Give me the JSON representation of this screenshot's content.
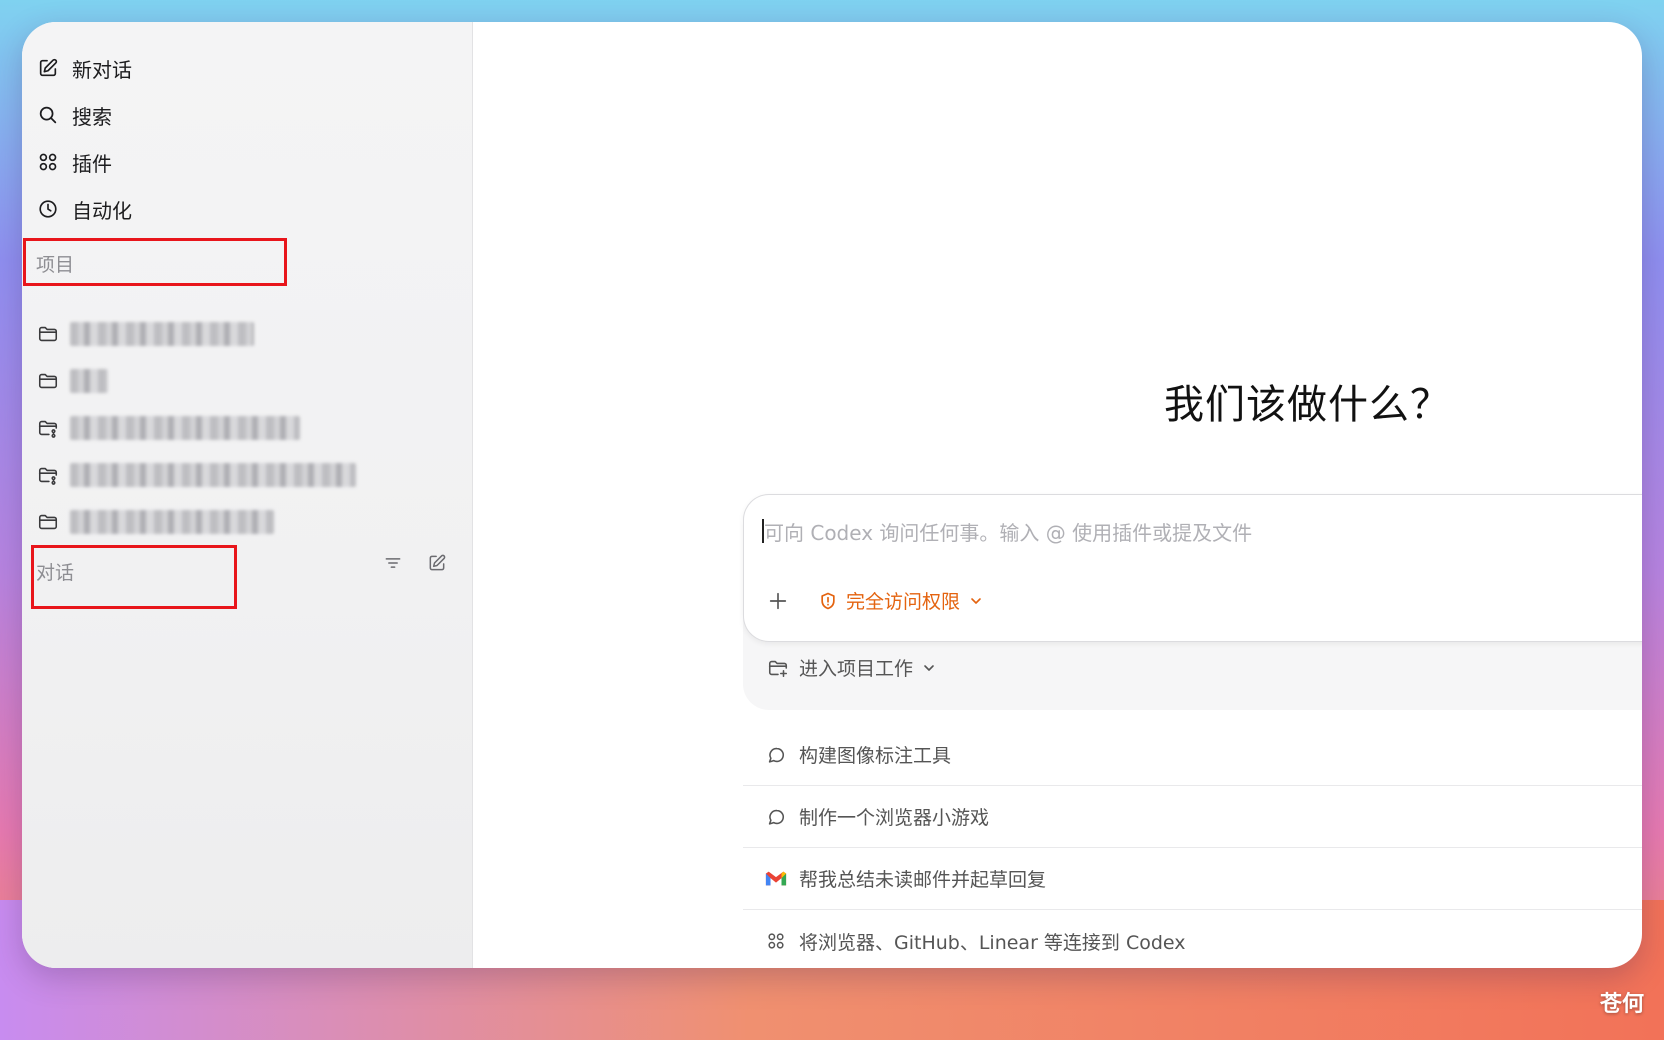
{
  "sidebar": {
    "nav": [
      {
        "label": "新对话",
        "icon": "compose-icon"
      },
      {
        "label": "搜索",
        "icon": "search-icon"
      },
      {
        "label": "插件",
        "icon": "plugins-grid-icon"
      },
      {
        "label": "自动化",
        "icon": "clock-icon"
      }
    ],
    "projects_label": "项目",
    "projects": [
      {
        "icon": "folder-icon"
      },
      {
        "icon": "folder-icon"
      },
      {
        "icon": "git-folder-icon"
      },
      {
        "icon": "git-folder-icon"
      },
      {
        "icon": "folder-icon"
      }
    ],
    "conversations_label": "对话",
    "conversation_actions": [
      {
        "icon": "filter-icon"
      },
      {
        "icon": "compose-icon"
      }
    ]
  },
  "main": {
    "headline": "我们该做什么？",
    "composer": {
      "placeholder": "可向 Codex 询问任何事。输入 @ 使用插件或提及文件",
      "access_label": "完全访问权限",
      "project_entry_label": "进入项目工作"
    },
    "suggestions": [
      {
        "label": "构建图像标注工具",
        "icon": "chat-bubble-icon"
      },
      {
        "label": "制作一个浏览器小游戏",
        "icon": "chat-bubble-icon"
      },
      {
        "label": "帮我总结未读邮件并起草回复",
        "icon": "gmail-icon"
      },
      {
        "label": "将浏览器、GitHub、Linear 等连接到 Codex",
        "icon": "plugins-grid-icon"
      }
    ]
  },
  "watermark": "苍何",
  "colors": {
    "accent_orange": "#e4630f",
    "highlight_red": "#e8151b"
  }
}
